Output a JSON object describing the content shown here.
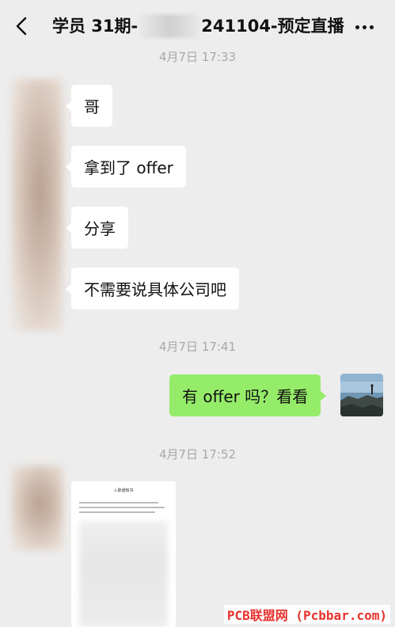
{
  "header": {
    "title_prefix": "学员 31期-",
    "title_suffix": "241104-预定直播"
  },
  "messages": {
    "ts1": "4月7日 17:33",
    "m1": "哥",
    "m2": "拿到了 offer",
    "m3": "分享",
    "m4": "不需要说具体公司吧",
    "ts2": "4月7日 17:41",
    "m5": "有 offer 吗？看看",
    "ts3": "4月7日 17:52"
  },
  "document": {
    "title": "入职通知书"
  },
  "watermark": "PCB联盟网 (Pcbbar.com)",
  "colors": {
    "background": "#ededed",
    "outgoing_bubble": "#95ec69",
    "incoming_bubble": "#ffffff",
    "timestamp": "#a8a8a8",
    "watermark": "#e8322d"
  },
  "icons": [
    "back-chevron-icon",
    "more-dots-icon"
  ]
}
